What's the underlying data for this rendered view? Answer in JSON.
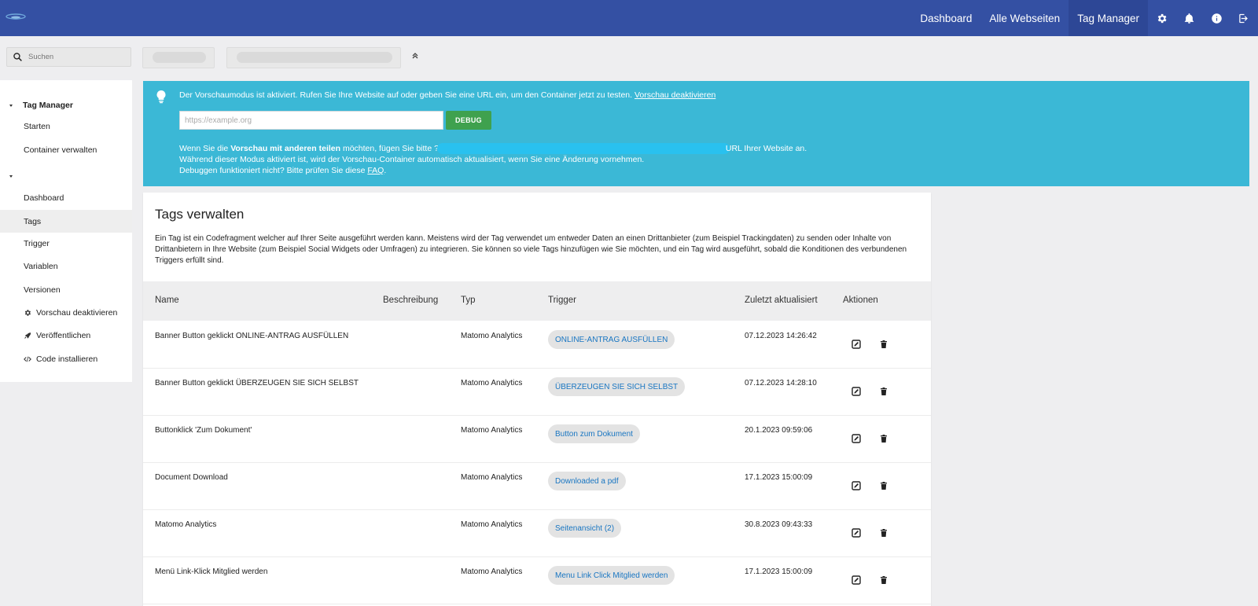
{
  "topnav": {
    "links": [
      "Dashboard",
      "Alle Webseiten",
      "Tag Manager"
    ],
    "active": "Tag Manager",
    "icons": [
      "gear-icon",
      "bell-icon",
      "info-icon",
      "logout-icon"
    ]
  },
  "search": {
    "placeholder": "Suchen"
  },
  "sidebar": {
    "section1": "Tag Manager",
    "items1": [
      "Starten",
      "Container verwalten"
    ],
    "section2": "",
    "items2": [
      "Dashboard",
      "Tags",
      "Trigger",
      "Variablen",
      "Versionen",
      "Vorschau deaktivieren",
      "Veröffentlichen",
      "Code installieren"
    ],
    "active": "Tags"
  },
  "banner": {
    "line1_text": "Der Vorschaumodus ist aktiviert. Rufen Sie Ihre Website auf oder geben Sie eine URL ein, um den Container jetzt zu testen.",
    "line1_link": "Vorschau deaktivieren",
    "url_placeholder": "https://example.org",
    "debug_label": "DEBUG",
    "line3_a": "Wenn Sie die",
    "line3_bold": "Vorschau mit anderen teilen",
    "line3_b": "möchten, fügen Sie bitte ?",
    "line3_c": "URL Ihrer Website an.",
    "line4": "Während dieser Modus aktiviert ist, wird der Vorschau-Container automatisch aktualisiert, wenn Sie eine Änderung vornehmen.",
    "line5_text": "Debuggen funktioniert nicht? Bitte prüfen Sie diese",
    "line5_link": "FAQ",
    "line5_end": "."
  },
  "card": {
    "title": "Tags verwalten",
    "description": "Ein Tag ist ein Codefragment welcher auf Ihrer Seite ausgeführt werden kann. Meistens wird der Tag verwendet um entweder Daten an einen Drittanbieter (zum Beispiel Trackingdaten) zu senden oder Inhalte von Drittanbietern in Ihre Website (zum Beispiel Social Widgets oder Umfragen) zu integrieren. Sie können so viele Tags hinzufügen wie Sie möchten, und ein Tag wird ausgeführt, sobald die Konditionen des verbundenen Triggers erfüllt sind."
  },
  "table": {
    "columns": [
      "Name",
      "Beschreibung",
      "Typ",
      "Trigger",
      "Zuletzt aktualisiert",
      "Aktionen"
    ],
    "rows": [
      {
        "name": "Banner Button geklickt ONLINE-ANTRAG AUSFÜLLEN",
        "type": "Matomo Analytics",
        "trigger": "ONLINE-ANTRAG AUSFÜLLEN",
        "updated": "07.12.2023 14:26:42"
      },
      {
        "name": "Banner Button geklickt ÜBERZEUGEN SIE SICH SELBST",
        "type": "Matomo Analytics",
        "trigger": "ÜBERZEUGEN SIE SICH SELBST",
        "updated": "07.12.2023 14:28:10"
      },
      {
        "name": "Buttonklick 'Zum Dokument'",
        "type": "Matomo Analytics",
        "trigger": "Button zum Dokument",
        "updated": "20.1.2023 09:59:06"
      },
      {
        "name": "Document Download",
        "type": "Matomo Analytics",
        "trigger": "Downloaded a pdf",
        "updated": "17.1.2023 15:00:09"
      },
      {
        "name": "Matomo Analytics",
        "type": "Matomo Analytics",
        "trigger": "Seitenansicht (2)",
        "updated": "30.8.2023 09:43:33"
      },
      {
        "name": "Menü Link-Klick Mitglied werden",
        "type": "Matomo Analytics",
        "trigger": "Menu Link Click Mitglied werden",
        "updated": "17.1.2023 15:00:09"
      }
    ]
  },
  "colors": {
    "topbar": "#3450a3",
    "banner": "#3bb8d6",
    "debug": "#3fa14e",
    "trigger_text": "#1976c2"
  }
}
